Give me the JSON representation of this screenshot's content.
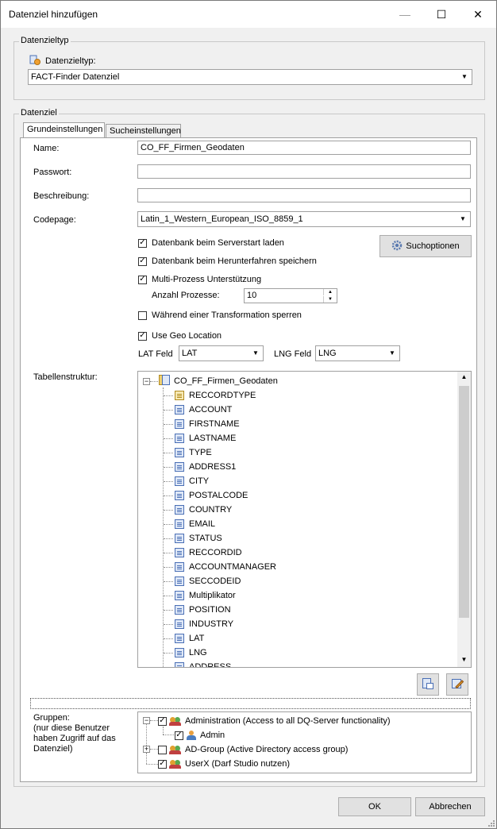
{
  "window": {
    "title": "Datenziel hinzufügen",
    "minimize": "—",
    "maximize": "☐",
    "close": "✕"
  },
  "datenzieltyp_group": {
    "legend": "Datenzieltyp",
    "label": "Datenzieltyp:",
    "selected": "FACT-Finder Datenziel"
  },
  "datenziel_group": {
    "legend": "Datenziel"
  },
  "tabs": [
    {
      "label": "Grundeinstellungen",
      "active": true
    },
    {
      "label": "Sucheinstellungen",
      "active": false
    }
  ],
  "form": {
    "name_label": "Name:",
    "name_value": "CO_FF_Firmen_Geodaten",
    "password_label": "Passwort:",
    "password_value": "",
    "description_label": "Beschreibung:",
    "description_value": "",
    "codepage_label": "Codepage:",
    "codepage_value": "Latin_1_Western_European_ISO_8859_1"
  },
  "options": {
    "load_on_start": {
      "label": "Datenbank beim Serverstart laden",
      "checked": true
    },
    "save_on_shutdown": {
      "label": "Datenbank beim Herunterfahren speichern",
      "checked": true
    },
    "multiprocess": {
      "label": "Multi-Prozess Unterstützung",
      "checked": true
    },
    "process_count_label": "Anzahl Prozesse:",
    "process_count": "10",
    "lock_during_transform": {
      "label": "Während einer Transformation sperren",
      "checked": false
    },
    "use_geo": {
      "label": "Use Geo Location",
      "checked": true
    },
    "lat_label": "LAT Feld",
    "lat_value": "LAT",
    "lng_label": "LNG Feld",
    "lng_value": "LNG",
    "search_options_button": "Suchoptionen"
  },
  "table_structure": {
    "label": "Tabellenstruktur:",
    "root": "CO_FF_Firmen_Geodaten",
    "fields": [
      "RECCORDTYPE",
      "ACCOUNT",
      "FIRSTNAME",
      "LASTNAME",
      "TYPE",
      "ADDRESS1",
      "CITY",
      "POSTALCODE",
      "COUNTRY",
      "EMAIL",
      "STATUS",
      "RECCORDID",
      "ACCOUNTMANAGER",
      "SECCODEID",
      "Multiplikator",
      "POSITION",
      "INDUSTRY",
      "LAT",
      "LNG",
      "ADDRESS"
    ]
  },
  "groups": {
    "label_line1": "Gruppen:",
    "label_line2": "(nur diese Benutzer",
    "label_line3": "haben Zugriff auf das",
    "label_line4": "Datenziel)",
    "items": [
      {
        "label": "Administration (Access to all DQ-Server functionality)",
        "checked": true
      },
      {
        "label": "Admin",
        "checked": true
      },
      {
        "label": "AD-Group (Active Directory access group)",
        "checked": false
      },
      {
        "label": "UserX (Darf Studio nutzen)",
        "checked": true
      }
    ]
  },
  "footer": {
    "ok": "OK",
    "cancel": "Abbrechen"
  }
}
